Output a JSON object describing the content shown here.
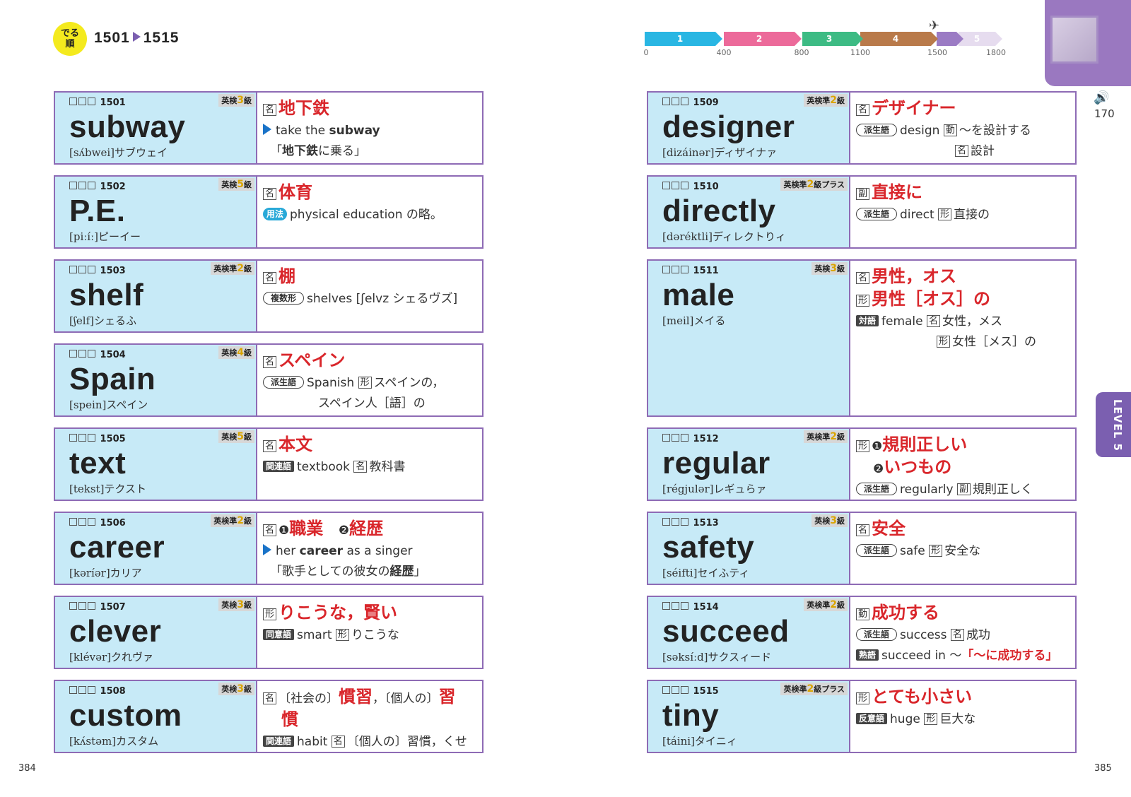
{
  "header": {
    "badge": "でる順",
    "badge_l1": "でる",
    "badge_l2": "順",
    "range_start": "1501",
    "range_end": "1515"
  },
  "progress": {
    "segments": [
      {
        "label": "1",
        "color": "#29b6e3"
      },
      {
        "label": "2",
        "color": "#ec6a9a"
      },
      {
        "label": "3",
        "color": "#3dbb84"
      },
      {
        "label": "4",
        "color": "#b97a4a"
      },
      {
        "label": "5",
        "color": "#9b7bc4"
      }
    ],
    "ticks": [
      "0",
      "400",
      "800",
      "1100",
      "1500",
      "1800"
    ]
  },
  "pages": {
    "left": "384",
    "right": "385",
    "corner_number": "170",
    "level_tab": "LEVEL 5"
  },
  "entries": [
    {
      "no": "1501",
      "level": "英検3級",
      "level_pre": "英検",
      "level_num": "3",
      "level_suf": "級",
      "word": "subway",
      "pron": "[sʌ́bwei]サブウェイ",
      "pos": "名",
      "meaning": "地下鉄",
      "ex_pre": "take the",
      "ex_bold": "subway",
      "trans_pre": "「",
      "trans_bold": "地下鉄",
      "trans_post": "に乗る」"
    },
    {
      "no": "1502",
      "level": "英検5級",
      "level_pre": "英検",
      "level_num": "5",
      "level_suf": "級",
      "word": "P.E.",
      "pron": "[piːíː]ピーイー",
      "pos": "名",
      "meaning": "体育",
      "tag": "用法",
      "note": "physical education の略。"
    },
    {
      "no": "1503",
      "level": "英検準2級",
      "level_pre": "英検準",
      "level_num": "2",
      "level_suf": "級",
      "word": "shelf",
      "pron": "[ʃelf]シェるふ",
      "pos": "名",
      "meaning": "棚",
      "tag": "複数形",
      "note": "shelves [ʃelvz シェるヴズ]"
    },
    {
      "no": "1504",
      "level": "英検4級",
      "level_pre": "英検",
      "level_num": "4",
      "level_suf": "級",
      "word": "Spain",
      "pron": "[spein]スペイン",
      "pos": "名",
      "meaning": "スペイン",
      "tag": "派生語",
      "note": "Spanish",
      "note_pos": "形",
      "note_mean": "スペインの，",
      "note_mean2": "スペイン人［語］の"
    },
    {
      "no": "1505",
      "level": "英検5級",
      "level_pre": "英検",
      "level_num": "5",
      "level_suf": "級",
      "word": "text",
      "pron": "[tekst]テクスト",
      "pos": "名",
      "meaning": "本文",
      "tag": "関連語",
      "note": "textbook",
      "note_pos": "名",
      "note_mean": "教科書"
    },
    {
      "no": "1506",
      "level": "英検準2級",
      "level_pre": "英検準",
      "level_num": "2",
      "level_suf": "級",
      "word": "career",
      "pron": "[kəríər]カリア",
      "pos": "名",
      "m1_mark": "❶",
      "meaning": "職業",
      "m2_mark": "❷",
      "meaning2": "経歴",
      "ex_pre": "her",
      "ex_bold": "career",
      "ex_post": "as a singer",
      "trans_pre": "「歌手としての彼女の",
      "trans_bold": "経歴",
      "trans_post": "」"
    },
    {
      "no": "1507",
      "level": "英検3級",
      "level_pre": "英検",
      "level_num": "3",
      "level_suf": "級",
      "word": "clever",
      "pron": "[klévər]クれヴァ",
      "pos": "形",
      "meaning": "りこうな，賢い",
      "tag": "同意語",
      "note": "smart",
      "note_pos": "形",
      "note_mean": "りこうな"
    },
    {
      "no": "1508",
      "level": "英検3級",
      "level_pre": "英検",
      "level_num": "3",
      "level_suf": "級",
      "word": "custom",
      "pron": "[kʌ́stəm]カスタム",
      "pos": "名",
      "ctx1": "〔社会の〕",
      "meaning": "慣習",
      "ctx2": "，〔個人の〕",
      "meaning2": "習",
      "meaning3": "慣",
      "tag": "関連語",
      "note": "habit",
      "note_pos": "名",
      "note_mean": "〔個人の〕習慣，くせ"
    },
    {
      "no": "1509",
      "level": "英検準2級",
      "level_pre": "英検準",
      "level_num": "2",
      "level_suf": "級",
      "word": "designer",
      "pron": "[dizáinər]ディザイナァ",
      "pos": "名",
      "meaning": "デザイナー",
      "tag": "派生語",
      "note": "design",
      "note_pos": "動",
      "note_mean": "〜を設計する",
      "note_pos2": "名",
      "note_mean2": "設計"
    },
    {
      "no": "1510",
      "level": "英検準2級プラス",
      "level_pre": "英検準",
      "level_num": "2",
      "level_suf": "級プラス",
      "word": "directly",
      "pron": "[dəréktli]ディレクトりィ",
      "pos": "副",
      "meaning": "直接に",
      "tag": "派生語",
      "note": "direct",
      "note_pos": "形",
      "note_mean": "直接の"
    },
    {
      "no": "1511",
      "level": "英検3級",
      "level_pre": "英検",
      "level_num": "3",
      "level_suf": "級",
      "word": "male",
      "pron": "[meil]メイる",
      "pos": "名",
      "meaning": "男性，オス",
      "pos2": "形",
      "meaning2": "男性［オス］の",
      "tag": "対語",
      "note": "female",
      "note_pos": "名",
      "note_mean": "女性，メス",
      "note_pos2": "形",
      "note_mean2": "女性［メス］の"
    },
    {
      "no": "1512",
      "level": "英検準2級",
      "level_pre": "英検準",
      "level_num": "2",
      "level_suf": "級",
      "word": "regular",
      "pron": "[régjulər]レギュらァ",
      "pos": "形",
      "m1_mark": "❶",
      "meaning": "規則正しい",
      "m2_mark": "❷",
      "meaning2": "いつもの",
      "tag": "派生語",
      "note": "regularly",
      "note_pos": "副",
      "note_mean": "規則正しく"
    },
    {
      "no": "1513",
      "level": "英検3級",
      "level_pre": "英検",
      "level_num": "3",
      "level_suf": "級",
      "word": "safety",
      "pron": "[séifti]セイふティ",
      "pos": "名",
      "meaning": "安全",
      "tag": "派生語",
      "note": "safe",
      "note_pos": "形",
      "note_mean": "安全な"
    },
    {
      "no": "1514",
      "level": "英検準2級",
      "level_pre": "英検準",
      "level_num": "2",
      "level_suf": "級",
      "word": "succeed",
      "pron": "[səksíːd]サクスィード",
      "pos": "動",
      "meaning": "成功する",
      "tag": "派生語",
      "note": "success",
      "note_pos": "名",
      "note_mean": "成功",
      "tag2": "熟語",
      "note2": "succeed in 〜",
      "note2_q1": "「",
      "note2_mean": "〜に成功する",
      "note2_q2": "」"
    },
    {
      "no": "1515",
      "level": "英検準2級プラス",
      "level_pre": "英検準",
      "level_num": "2",
      "level_suf": "級プラス",
      "word": "tiny",
      "pron": "[táini]タイニィ",
      "pos": "形",
      "meaning": "とても小さい",
      "tag": "反意語",
      "note": "huge",
      "note_pos": "形",
      "note_mean": "巨大な"
    }
  ]
}
